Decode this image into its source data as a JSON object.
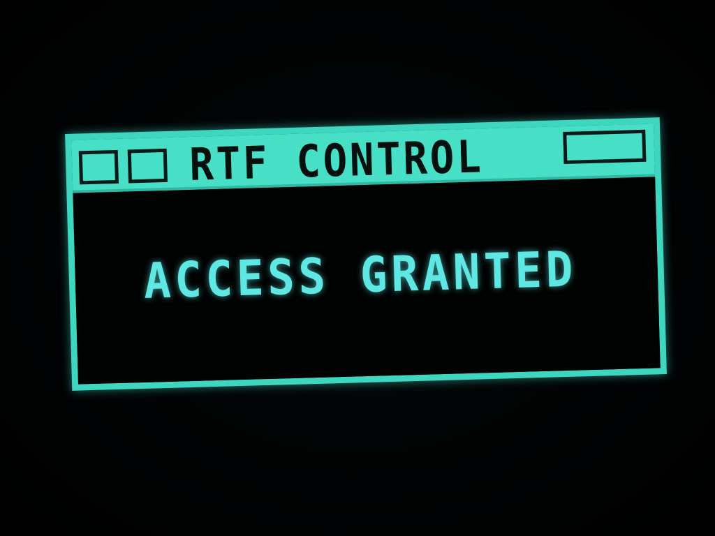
{
  "window": {
    "title": "RTF CONTROL",
    "message": "ACCESS GRANTED",
    "title_bar_buttons": [
      "close-box",
      "zoom-box",
      "resize-box"
    ]
  },
  "colors": {
    "accent": "#47e0c6",
    "message_text": "#5fe7e3",
    "background": "#000000"
  }
}
